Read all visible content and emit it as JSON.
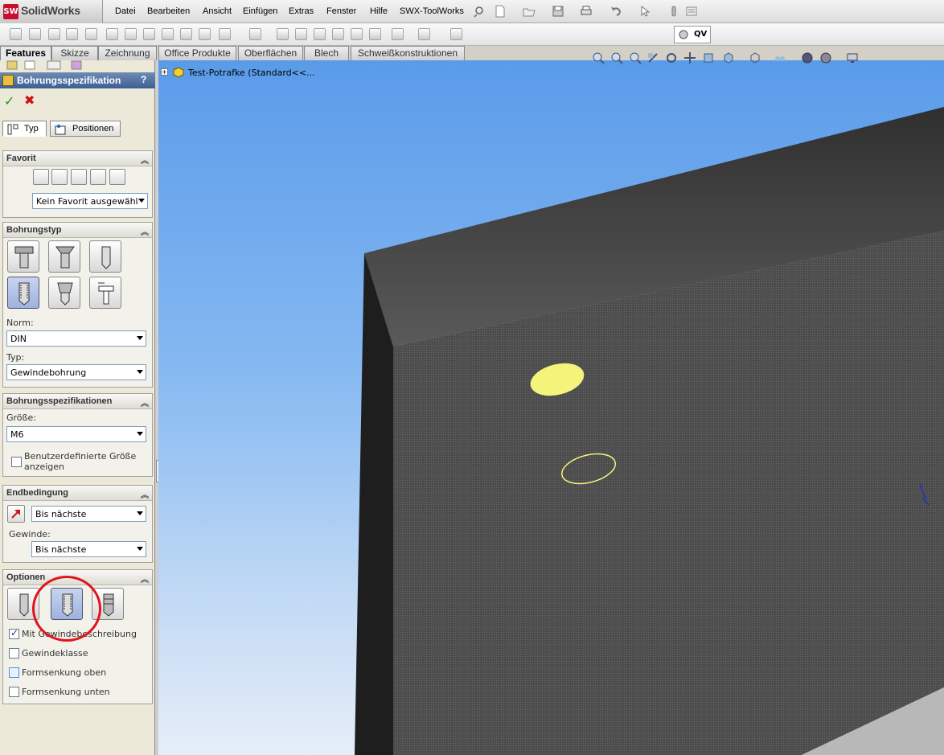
{
  "app": {
    "logo_mark": "SW",
    "logo_text": "SolidWorks"
  },
  "menu": [
    "Datei",
    "Bearbeiten",
    "Ansicht",
    "Einfügen",
    "Extras",
    "Fenster",
    "Hilfe",
    "SWX-ToolWorks"
  ],
  "quickview": {
    "label": "QV"
  },
  "tabs": [
    "Features",
    "Skizze",
    "Zeichnung",
    "Office Produkte",
    "Oberflächen",
    "Blech",
    "Schweißkonstruktionen"
  ],
  "panel": {
    "title": "Bohrungsspezifikation",
    "help": "?",
    "ok": "✓",
    "cancel": "✖",
    "tabs": [
      "Typ",
      "Positionen"
    ],
    "favorit": {
      "header": "Favorit",
      "select": "Kein Favorit ausgewähl"
    },
    "bohrungstyp": {
      "header": "Bohrungstyp",
      "norm_label": "Norm:",
      "norm_value": "DIN",
      "typ_label": "Typ:",
      "typ_value": "Gewindebohrung"
    },
    "spezifikationen": {
      "header": "Bohrungsspezifikationen",
      "groesse_label": "Größe:",
      "groesse_value": "M6",
      "custom_size_line1": "Benutzerdefinierte Größe",
      "custom_size_line2": "anzeigen"
    },
    "endbedingung": {
      "header": "Endbedingung",
      "value": "Bis nächste",
      "gewinde_label": "Gewinde:",
      "gewinde_value": "Bis nächste"
    },
    "optionen": {
      "header": "Optionen",
      "checks": [
        {
          "label": "Mit Gewindebeschreibung",
          "checked": true
        },
        {
          "label": "Gewindeklasse",
          "checked": false
        },
        {
          "label": "Formsenkung oben",
          "checked": false
        },
        {
          "label": "Formsenkung unten",
          "checked": false
        }
      ]
    }
  },
  "tree": {
    "expander": "+",
    "part_name": "Test-Potrafke  (Standard<<..."
  },
  "colors": {
    "accent_header": "#3d5f94",
    "ok": "#1a9a1a",
    "cancel": "#d01010",
    "highlight_circle": "#e0141e",
    "hole_highlight": "#f4f47a"
  }
}
